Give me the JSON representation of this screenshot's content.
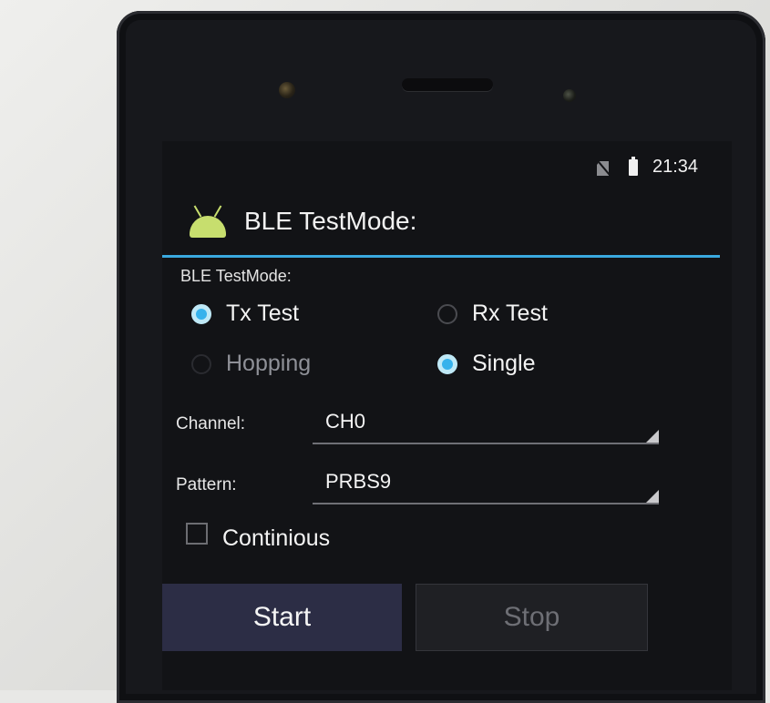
{
  "statusbar": {
    "time": "21:34",
    "icons": [
      "no-sim-icon",
      "battery-icon"
    ]
  },
  "app": {
    "title": "BLE TestMode:",
    "icon": "android-icon"
  },
  "form": {
    "section_label": "BLE TestMode:",
    "radios": {
      "tx": {
        "label": "Tx Test",
        "checked": true
      },
      "rx": {
        "label": "Rx Test",
        "checked": false
      },
      "hopping": {
        "label": "Hopping",
        "checked": false,
        "disabled": true
      },
      "single": {
        "label": "Single",
        "checked": true
      }
    },
    "channel": {
      "label": "Channel:",
      "value": "CH0"
    },
    "pattern": {
      "label": "Pattern:",
      "value": "PRBS9"
    },
    "continuous": {
      "label": "Continious",
      "checked": false
    }
  },
  "buttons": {
    "start": {
      "label": "Start",
      "enabled": true
    },
    "stop": {
      "label": "Stop",
      "enabled": false
    }
  },
  "colors": {
    "accent": "#36b2ec",
    "divider": "#3aa9df",
    "android_green": "#c7de6e"
  }
}
